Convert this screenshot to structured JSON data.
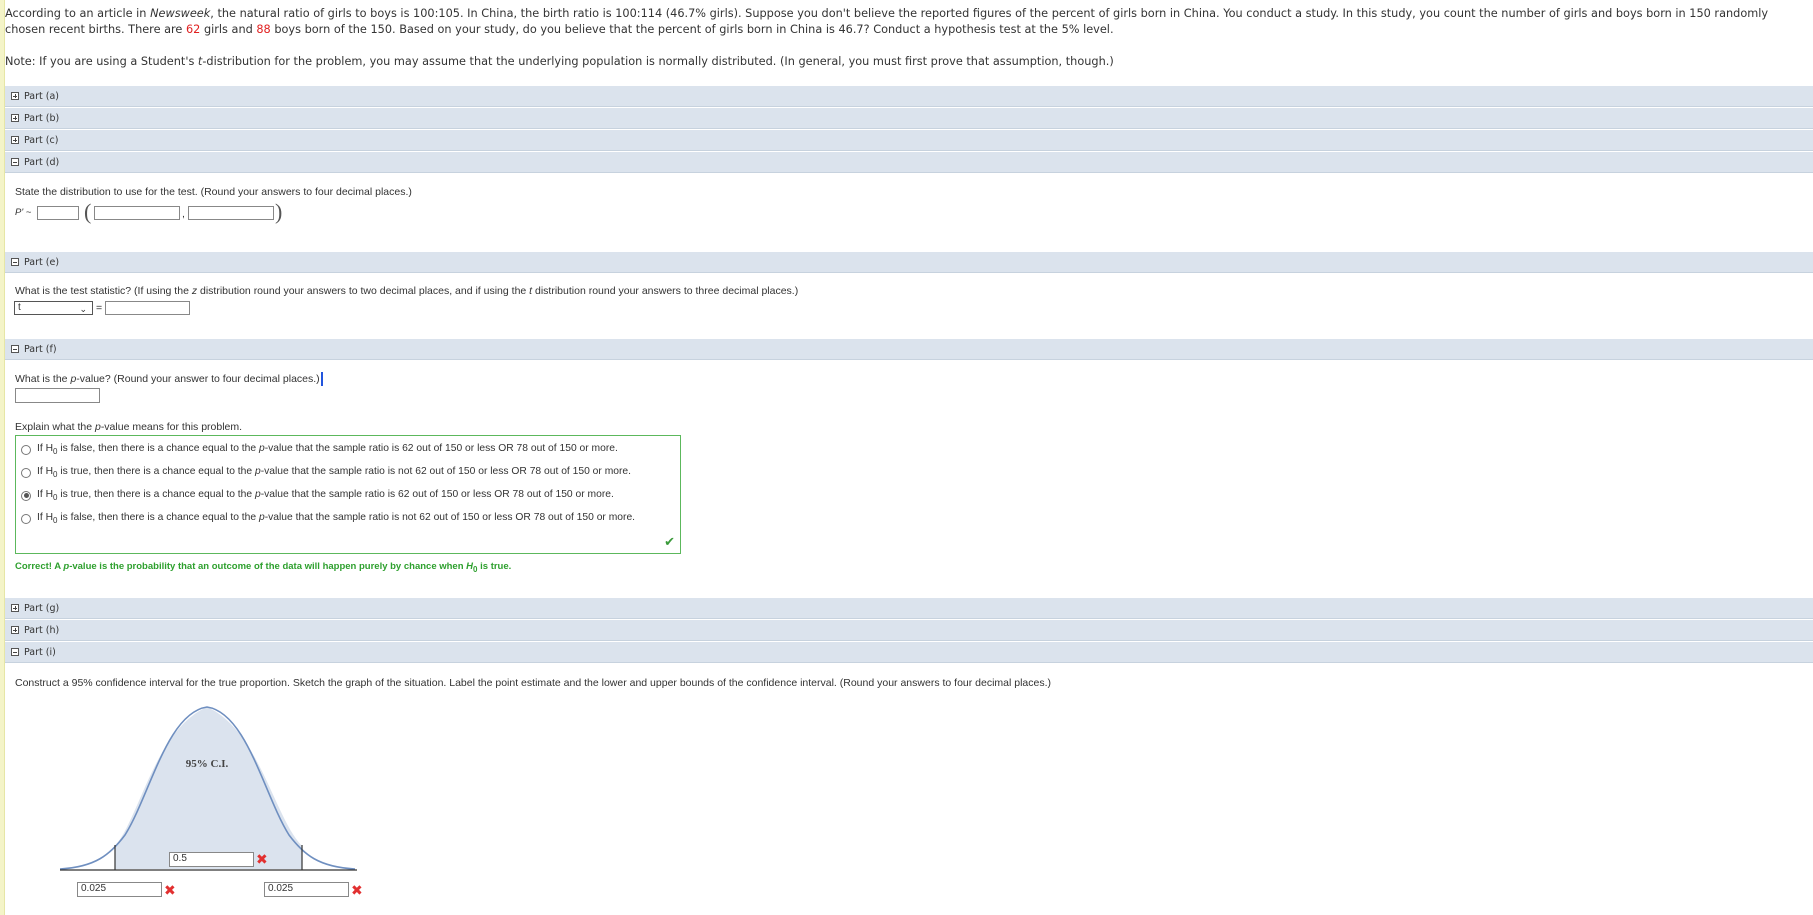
{
  "problem": {
    "p1": "According to an article in ",
    "magazine": "Newsweek",
    "p2": ", the natural ratio of girls to boys is 100:105. In China, the birth ratio is 100:114 (46.7% girls). Suppose you don't believe the reported figures of the percent of girls born in China. You conduct a study. In this study, you count the number of girls and boys born in 150 randomly chosen recent births. There are ",
    "girls": "62",
    "p3": " girls and ",
    "boys": "88",
    "p4": " boys born of the 150. Based on your study, do you believe that the percent of girls born in China is 46.7? Conduct a hypothesis test at the 5% level."
  },
  "note": {
    "p1": "Note: If you are using a Student's ",
    "t": "t",
    "p2": "-distribution for the problem, you may assume that the underlying population is normally distributed. (In general, you must first prove that assumption, though.)"
  },
  "parts": {
    "a": "Part (a)",
    "b": "Part (b)",
    "c": "Part (c)",
    "d": "Part (d)",
    "e": "Part (e)",
    "f": "Part (f)",
    "g": "Part (g)",
    "h": "Part (h)",
    "i": "Part (i)"
  },
  "part_d": {
    "question": "State the distribution to use for the test. (Round your answers to four decimal places.)",
    "var": "P' ~",
    "comma": ","
  },
  "part_e": {
    "q1": "What is the test statistic? (If using the ",
    "z": "z",
    "q2": " distribution round your answers to two decimal places, and if using the ",
    "t": "t",
    "q3": " distribution round your answers to three decimal places.)",
    "select_value": "t",
    "equals": "="
  },
  "part_f": {
    "q1": "What is the ",
    "p": "p",
    "q2": "-value? (Round your answer to four decimal places.)",
    "explain1": "Explain what the ",
    "explain_p": "p",
    "explain2": "-value means for this problem.",
    "options": [
      {
        "pre": "If H",
        "sub": "0",
        "mid": " is false, then there is a chance equal to the ",
        "p": "p",
        "post": "-value that the sample ratio is 62 out of 150 or less OR 78 out of 150 or more."
      },
      {
        "pre": "If H",
        "sub": "0",
        "mid": " is true, then there is a chance equal to the ",
        "p": "p",
        "post": "-value that the sample ratio is not 62 out of 150 or less OR 78 out of 150 or more."
      },
      {
        "pre": "If H",
        "sub": "0",
        "mid": " is true, then there is a chance equal to the ",
        "p": "p",
        "post": "-value that the sample ratio is 62 out of 150 or less OR 78 out of 150 or more."
      },
      {
        "pre": "If H",
        "sub": "0",
        "mid": " is false, then there is a chance equal to the ",
        "p": "p",
        "post": "-value that the sample ratio is not 62 out of 150 or less OR 78 out of 150 or more."
      }
    ],
    "selected_index": 2,
    "feedback1": "Correct! A ",
    "feedback_p": "p",
    "feedback2": "-value is the probability that an outcome of the data will happen purely by chance when ",
    "feedback_h": "H",
    "feedback_sub": "0",
    "feedback3": " is true."
  },
  "part_i": {
    "question": "Construct a 95% confidence interval for the true proportion. Sketch the graph of the situation. Label the point estimate and the lower and upper bounds of the confidence interval. (Round your answers to four decimal places.)",
    "ci_label": "95% C.I.",
    "center_input": "0.5",
    "left_input": "0.025",
    "right_input": "0.025"
  },
  "colors": {
    "part_bar": "#dbe3ed",
    "correct": "#2ea02e",
    "error": "#e23030",
    "curve_fill": "#dbe3ee",
    "curve_stroke": "#6f8fc0"
  },
  "icons": {
    "expand": "plus-box-icon",
    "collapse": "minus-box-icon",
    "correct": "checkmark-icon",
    "wrong": "x-mark-icon"
  }
}
